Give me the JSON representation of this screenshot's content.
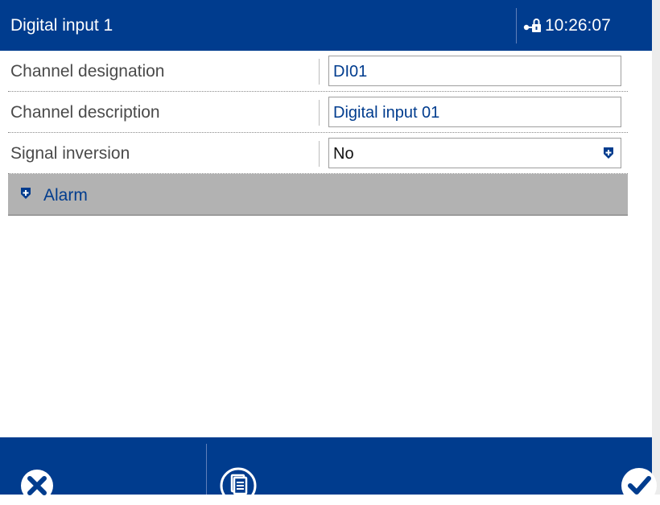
{
  "header": {
    "title": "Digital input 1",
    "time": "10:26:07",
    "icon": "user-lock-icon"
  },
  "fields": [
    {
      "label": "Channel designation",
      "value": "DI01",
      "type": "text"
    },
    {
      "label": "Channel description",
      "value": "Digital input 01",
      "type": "text"
    },
    {
      "label": "Signal inversion",
      "value": "No",
      "type": "select",
      "icon": "dropdown-arrow-icon"
    }
  ],
  "group": {
    "label": "Alarm",
    "icon": "expand-icon"
  },
  "footer": {
    "cancel_icon": "cancel-icon",
    "document_icon": "document-icon",
    "confirm_icon": "checkmark-icon"
  },
  "colors": {
    "primary": "#003c8e",
    "group_bg": "#b2b2b2",
    "label_text": "#4a4a4a"
  }
}
